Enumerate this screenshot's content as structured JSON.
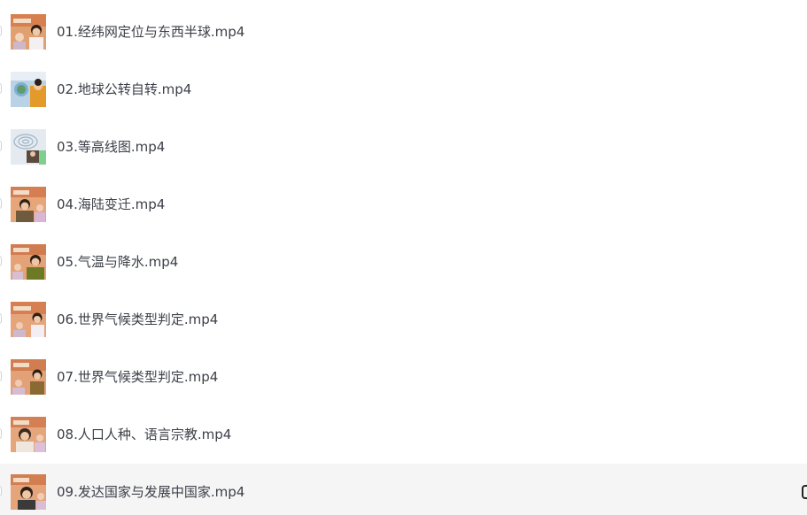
{
  "files": [
    {
      "name": "01.经纬网定位与东西半球.mp4",
      "thumb": "presenter"
    },
    {
      "name": "02.地球公转自转.mp4",
      "thumb": "globe"
    },
    {
      "name": "03.等高线图.mp4",
      "thumb": "contour-map"
    },
    {
      "name": "04.海陆变迁.mp4",
      "thumb": "presenter"
    },
    {
      "name": "05.气温与降水.mp4",
      "thumb": "presenter"
    },
    {
      "name": "06.世界气候类型判定.mp4",
      "thumb": "presenter"
    },
    {
      "name": "07.世界气候类型判定.mp4",
      "thumb": "presenter"
    },
    {
      "name": "08.人口人种、语言宗教.mp4",
      "thumb": "presenter"
    },
    {
      "name": "09.发达国家与发展中国家.mp4",
      "thumb": "presenter"
    }
  ],
  "selected_index": 8
}
